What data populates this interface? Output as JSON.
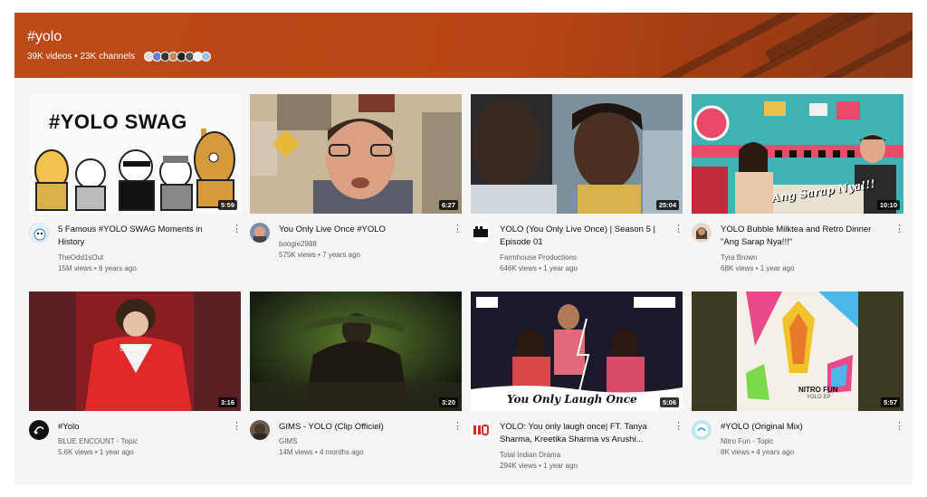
{
  "hashtag": {
    "title": "#yolo",
    "stats": "39K videos • 23K channels"
  },
  "videos": [
    {
      "title": "5 Famous #YOLO SWAG Moments in History",
      "channel": "TheOdd1sOut",
      "stats": "15M views • 6 years ago",
      "duration": "5:59",
      "thumb_text": "#YOLO SWAG"
    },
    {
      "title": "You Only Live Once #YOLO",
      "channel": "boogie2988",
      "stats": "575K views • 7 years ago",
      "duration": "6:27"
    },
    {
      "title": "YOLO (You Only Live Once) | Season 5 | Episode 01",
      "channel": "Farmhouse Productions",
      "stats": "646K views • 1 year ago",
      "duration": "25:04"
    },
    {
      "title": "YOLO Bubble Milktea and Retro Dinner \"Ang Sarap Nya!!!\"",
      "channel": "Tyra Brown",
      "stats": "68K views • 1 year ago",
      "duration": "10:10",
      "thumb_text": "Ang Sarap Nya!!!"
    },
    {
      "title": "#Yolo",
      "channel": "BLUE ENCOUNT - Topic",
      "stats": "5.6K views • 1 year ago",
      "duration": "3:16"
    },
    {
      "title": "GIMS - YOLO (Clip Officiel)",
      "channel": "GIMS",
      "stats": "14M views • 4 months ago",
      "duration": "3:20"
    },
    {
      "title": "YOLO: You only laugh once| FT. Tanya Sharma, Kreetika Sharma vs Arushi...",
      "channel": "Total Indian Drama",
      "stats": "294K views • 1 year ago",
      "duration": "5:06",
      "thumb_text": "You Only Laugh Once"
    },
    {
      "title": "#YOLO (Original Mix)",
      "channel": "Nitro Fun - Topic",
      "stats": "8K views • 4 years ago",
      "duration": "5:57",
      "thumb_text": "NITRO FUN",
      "thumb_subtext": "YOLO EP"
    }
  ],
  "icons": {
    "more": "vertical-dots-icon"
  },
  "colors": {
    "banner": "#b94616",
    "duration_bg": "#000000",
    "meta_text": "#606060"
  }
}
